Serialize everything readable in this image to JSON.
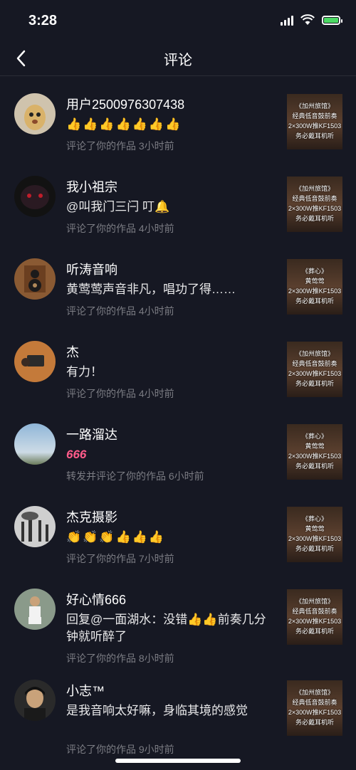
{
  "status": {
    "time": "3:28"
  },
  "nav": {
    "title": "评论"
  },
  "items": [
    {
      "name": "用户2500976307438",
      "comment": "👍👍👍👍👍👍👍",
      "meta": "评论了你的作品  3小时前",
      "thumb": "《加州旅馆》\n经典低音鼓前奏\n2×300W推KF1503\n务必戴耳机听"
    },
    {
      "name": "我小祖宗",
      "comment": "@叫我门三闩 叮🔔",
      "meta": "评论了你的作品  4小时前",
      "thumb": "《加州旅馆》\n经典低音鼓前奏\n2×300W推KF1503\n务必戴耳机听"
    },
    {
      "name": "听涛音响",
      "comment": "黄莺莺声音非凡，唱功了得……",
      "meta": "评论了你的作品  4小时前",
      "thumb": "《葬心》\n黄莺莺\n2×300W推KF1503\n务必戴耳机听"
    },
    {
      "name": "杰",
      "comment": "有力！",
      "meta": "评论了你的作品  4小时前",
      "thumb": "《加州旅馆》\n经典低音鼓前奏\n2×300W推KF1503\n务必戴耳机听"
    },
    {
      "name": "一路溜达",
      "comment": "666",
      "meta": "转发并评论了你的作品  6小时前",
      "thumb": "《葬心》\n黄莺莺\n2×300W推KF1503\n务必戴耳机听"
    },
    {
      "name": "杰克摄影",
      "comment": "👏👏👏👍👍👍",
      "meta": "评论了你的作品  7小时前",
      "thumb": "《葬心》\n黄莺莺\n2×300W推KF1503\n务必戴耳机听"
    },
    {
      "name": "好心情666",
      "comment": "回复@一面湖水：没错👍👍前奏几分钟就听醉了",
      "meta": "评论了你的作品  8小时前",
      "thumb": "《加州旅馆》\n经典低音鼓前奏\n2×300W推KF1503\n务必戴耳机听"
    },
    {
      "name": "小志™",
      "comment": "是我音响太好嘛，身临其境的感觉",
      "meta": "评论了你的作品  9小时前",
      "thumb": "《加州旅馆》\n经典低音鼓前奏\n2×300W推KF1503\n务必戴耳机听"
    }
  ]
}
